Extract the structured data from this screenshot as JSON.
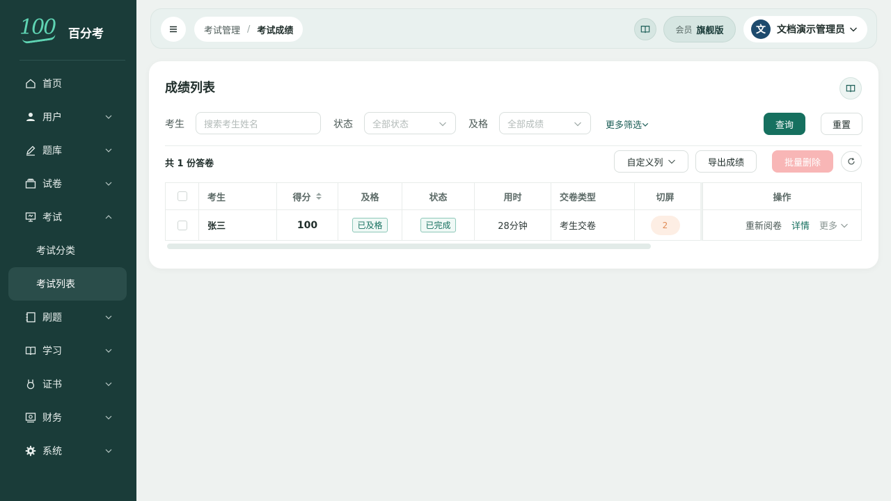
{
  "brand": {
    "logo": "100",
    "name": "百分考"
  },
  "sidebar": {
    "items": [
      {
        "label": "首页",
        "icon": "home-icon"
      },
      {
        "label": "用户",
        "icon": "user-icon"
      },
      {
        "label": "题库",
        "icon": "pen-icon"
      },
      {
        "label": "试卷",
        "icon": "paper-stack-icon"
      },
      {
        "label": "考试",
        "icon": "monitor-icon"
      },
      {
        "label": "刷题",
        "icon": "notebook-icon"
      },
      {
        "label": "学习",
        "icon": "book-icon"
      },
      {
        "label": "证书",
        "icon": "medal-icon"
      },
      {
        "label": "财务",
        "icon": "wallet-icon"
      },
      {
        "label": "系统",
        "icon": "gear-icon"
      }
    ],
    "exam_sub": [
      {
        "label": "考试分类"
      },
      {
        "label": "考试列表"
      }
    ]
  },
  "header": {
    "breadcrumb": [
      "考试管理",
      "考试成绩"
    ],
    "breadcrumb_sep": "/",
    "member_label": "会员",
    "member_level": "旗舰版",
    "avatar_letter": "文",
    "user_name": "文档演示管理员"
  },
  "main": {
    "title": "成绩列表",
    "filters": {
      "candidate_label": "考生",
      "candidate_placeholder": "搜索考生姓名",
      "status_label": "状态",
      "status_value": "全部状态",
      "pass_label": "及格",
      "pass_value": "全部成绩",
      "more_filters": "更多筛选",
      "query_button": "查询",
      "reset_button": "重置"
    },
    "toolbar": {
      "count_prefix": "共",
      "count": "1",
      "count_suffix": "份答卷",
      "custom_columns": "自定义列",
      "export": "导出成绩",
      "batch_delete": "批量删除"
    },
    "table": {
      "headers": [
        "考生",
        "得分",
        "及格",
        "状态",
        "用时",
        "交卷类型",
        "切屏",
        "操作"
      ],
      "rows": [
        {
          "name": "张三",
          "score": "100",
          "pass": "已及格",
          "status": "已完成",
          "duration": "28分钟",
          "submit_type": "考生交卷",
          "switch_count": "2",
          "actions": {
            "regrade": "重新阅卷",
            "detail": "详情",
            "more": "更多"
          }
        }
      ]
    }
  },
  "colors": {
    "sidebar_bg": "#1a3c39",
    "accent": "#16705f",
    "danger_disabled": "#f8b6b6"
  }
}
